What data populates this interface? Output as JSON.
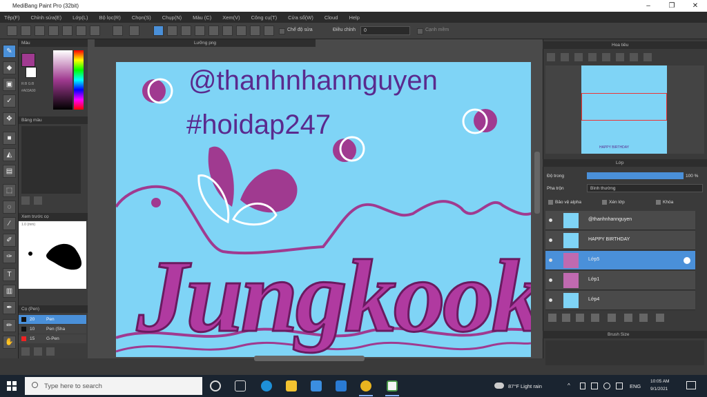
{
  "window": {
    "title": "MediBang Paint Pro (32bit)",
    "minimize": "–",
    "maximize": "❐",
    "close": "✕"
  },
  "menu": [
    "Tệp(F)",
    "Chỉnh sửa(E)",
    "Lớp(L)",
    "Bộ lọc(R)",
    "Chọn(S)",
    "Chụp(N)",
    "Màu (C)",
    "Xem(V)",
    "Công cụ(T)",
    "Cửa sổ(W)",
    "Cloud",
    "Help"
  ],
  "toolbar": {
    "stabilizer_label": "Chế độ sửa",
    "adjust_label": "Điều chỉnh",
    "adjust_value": "0",
    "antialias_label": "Cạnh mềm"
  },
  "panels": {
    "color": "Màu",
    "palette": "Bảng màu",
    "brush_preview": "Xem trước cọ",
    "brush": "Cọ (Pen)",
    "navigator": "Hoa tiêu",
    "layer": "Lớp",
    "brush_size": "Brush Size"
  },
  "canvas": {
    "tab": "Lưỡng png",
    "credit": "@thanhnhannguyen",
    "hashtag": "#hoidap247",
    "art_text": "Jungkook"
  },
  "color_info": {
    "rgb": "R:B G:B",
    "hex": "#A03A90"
  },
  "brush_list": [
    {
      "size": "20",
      "name": "Pen"
    },
    {
      "size": "10",
      "name": "Pen (Sha"
    },
    {
      "size": "15",
      "name": "G-Pen"
    }
  ],
  "brush_preview": {
    "size": "1.0 (mm)"
  },
  "navigator": {
    "banner": "HAPPY BIRTHDAY"
  },
  "layer_panel": {
    "opacity_label": "Độ trong",
    "opacity_value": "100 %",
    "blend_label": "Pha trộn",
    "blend_value": "Bình thường",
    "protect_alpha": "Bảo vệ alpha",
    "clipping": "Xén lớp",
    "lock": "Khóa",
    "layers": [
      {
        "name": "@thanhnhannguyen",
        "selected": false
      },
      {
        "name": "HAPPY BIRTHDAY",
        "selected": false
      },
      {
        "name": "Lớp5",
        "selected": true
      },
      {
        "name": "Lớp1",
        "selected": false
      },
      {
        "name": "Lớp4",
        "selected": false
      }
    ]
  },
  "taskbar": {
    "search_placeholder": "Type here to search",
    "weather": "87°F  Light rain",
    "lang": "ENG",
    "time": "10:05 AM",
    "date": "9/1/2021"
  },
  "colors": {
    "canvas_bg": "#7fd4f6",
    "accent": "#a03a90",
    "text_purple": "#5a2a8e",
    "selected_layer": "#4a90d9"
  }
}
